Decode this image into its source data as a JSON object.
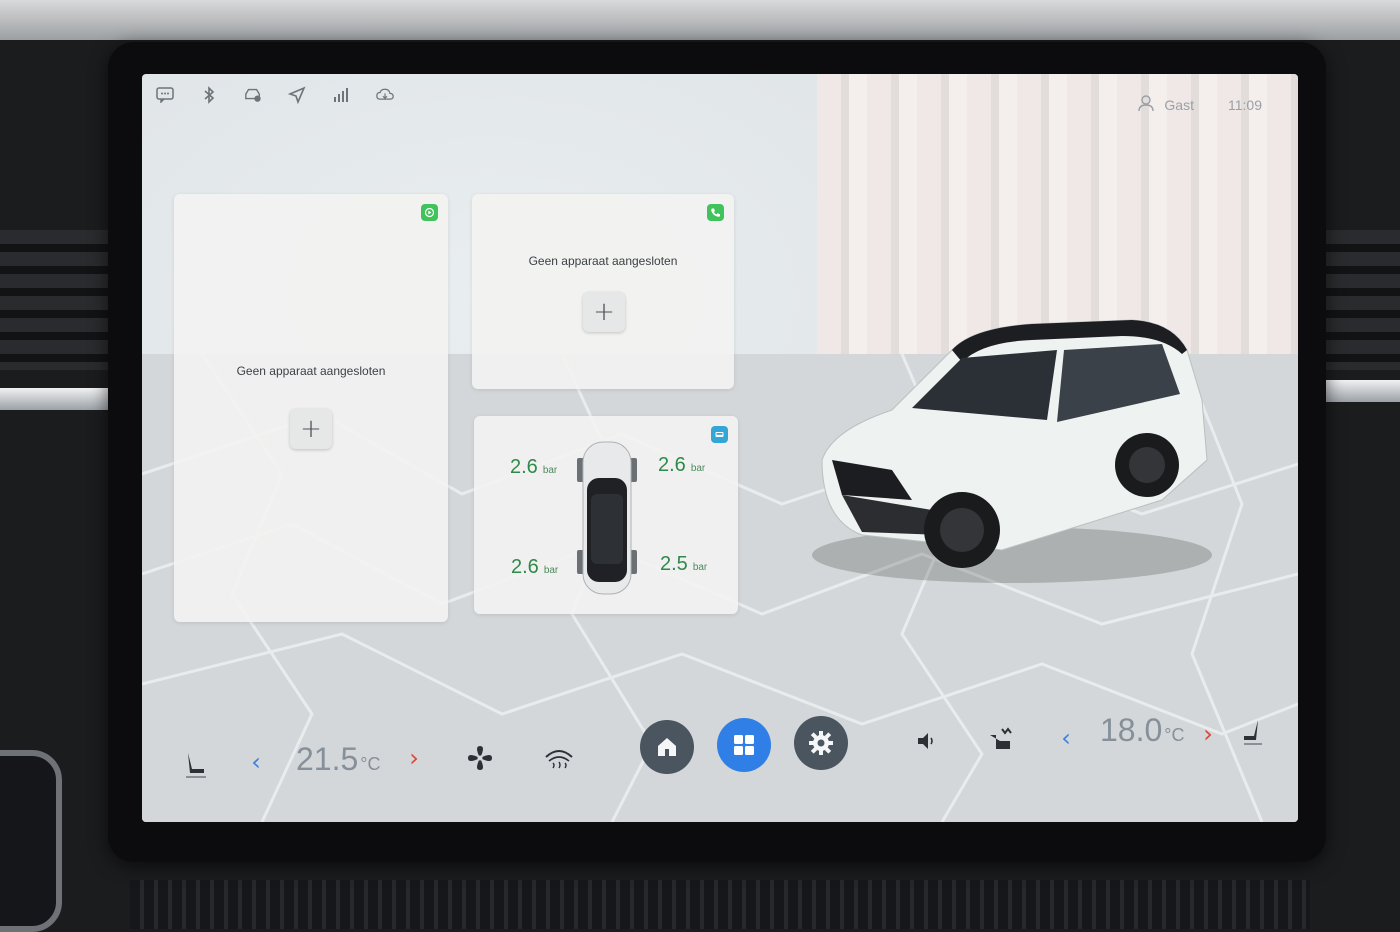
{
  "status_bar": {
    "icons": [
      "message-icon",
      "bluetooth-icon",
      "car-settings-icon",
      "navigation-icon",
      "signal-icon",
      "cloud-icon"
    ],
    "user_label": "Gast",
    "time": "11:09"
  },
  "cards": {
    "carplay": {
      "icon": "carplay-icon",
      "accent": "#3fc35a",
      "message": "Geen apparaat aangesloten",
      "add_label": "+"
    },
    "phone": {
      "icon": "phone-icon",
      "accent": "#3fc35a",
      "message": "Geen apparaat aangesloten",
      "add_label": "+"
    },
    "tire_pressure": {
      "icon": "car-icon",
      "accent": "#33a6d8",
      "front_left": "2.6",
      "front_right": "2.6",
      "rear_left": "2.6",
      "rear_right": "2.5",
      "unit": "bar"
    }
  },
  "climate": {
    "driver_temp": "21.5",
    "passenger_temp": "18.0",
    "temp_unit": "°C"
  },
  "dock": {
    "home_color": "#4a5560",
    "apps_color": "#2f7fe6",
    "settings_color": "#4a5560"
  }
}
